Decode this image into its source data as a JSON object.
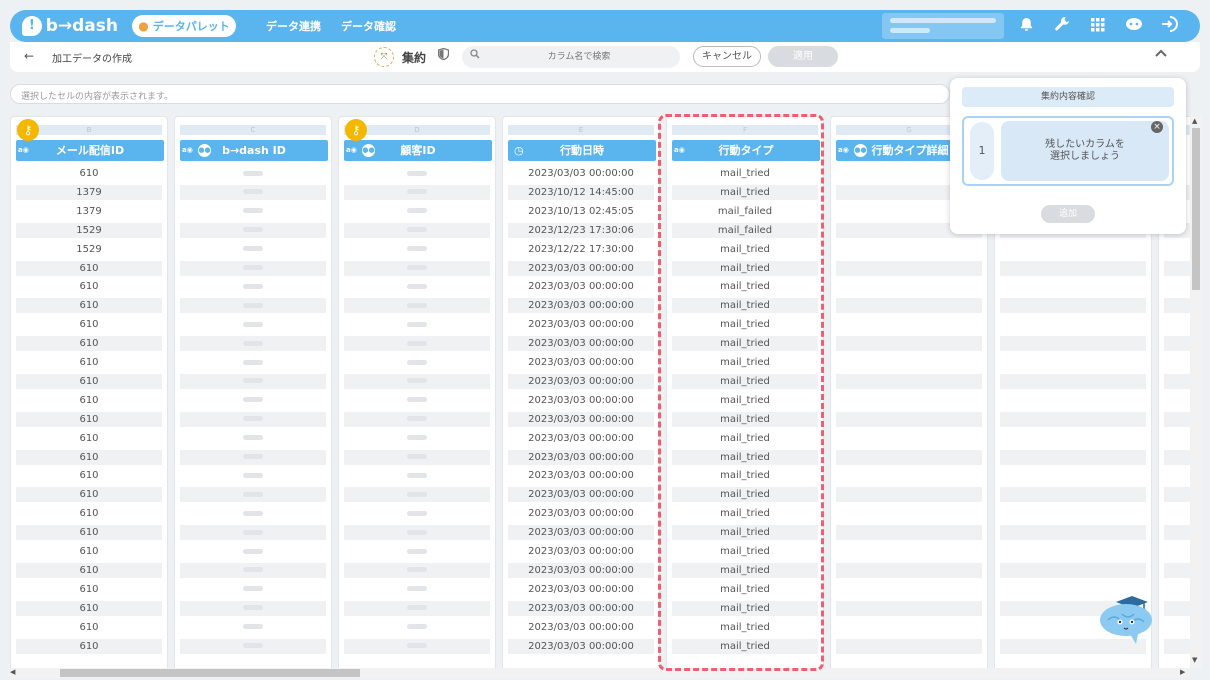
{
  "brand": {
    "name": "b→dash"
  },
  "nav": {
    "palette_label": "データパレット",
    "links": [
      "データ連携",
      "データ確認"
    ]
  },
  "toolbar": {
    "back_glyph": "←",
    "page_title": "加工データの作成",
    "mode_label": "集約",
    "search_placeholder": "カラム名で検索",
    "cancel_label": "キャンセル",
    "apply_label": "適用"
  },
  "cell_content": {
    "placeholder": "選択したセルの内容が表示されます。"
  },
  "columns": [
    {
      "letter": "B",
      "header": "メール配信ID",
      "tag": "a",
      "key": true
    },
    {
      "letter": "C",
      "header": "b→dash ID",
      "tag": "a",
      "key": false
    },
    {
      "letter": "D",
      "header": "顧客ID",
      "tag": "a",
      "key": true
    },
    {
      "letter": "E",
      "header": "行動日時",
      "tag": "",
      "key": false
    },
    {
      "letter": "F",
      "header": "行動タイプ",
      "tag": "a",
      "key": false
    },
    {
      "letter": "G",
      "header": "行動タイプ詳細",
      "tag": "a",
      "key": false
    }
  ],
  "mail_ids": [
    "610",
    "1379",
    "1379",
    "1529",
    "1529",
    "610",
    "610",
    "610",
    "610",
    "610",
    "610",
    "610",
    "610",
    "610",
    "610",
    "610",
    "610",
    "610",
    "610",
    "610",
    "610",
    "610",
    "610",
    "610",
    "610",
    "610"
  ],
  "datetimes": [
    "2023/03/03 00:00:00",
    "2023/10/12 14:45:00",
    "2023/10/13 02:45:05",
    "2023/12/23 17:30:06",
    "2023/12/22 17:30:00",
    "2023/03/03 00:00:00",
    "2023/03/03 00:00:00",
    "2023/03/03 00:00:00",
    "2023/03/03 00:00:00",
    "2023/03/03 00:00:00",
    "2023/03/03 00:00:00",
    "2023/03/03 00:00:00",
    "2023/03/03 00:00:00",
    "2023/03/03 00:00:00",
    "2023/03/03 00:00:00",
    "2023/03/03 00:00:00",
    "2023/03/03 00:00:00",
    "2023/03/03 00:00:00",
    "2023/03/03 00:00:00",
    "2023/03/03 00:00:00",
    "2023/03/03 00:00:00",
    "2023/03/03 00:00:00",
    "2023/03/03 00:00:00",
    "2023/03/03 00:00:00",
    "2023/03/03 00:00:00",
    "2023/03/03 00:00:00"
  ],
  "action_types": [
    "mail_tried",
    "mail_tried",
    "mail_failed",
    "mail_failed",
    "mail_tried",
    "mail_tried",
    "mail_tried",
    "mail_tried",
    "mail_tried",
    "mail_tried",
    "mail_tried",
    "mail_tried",
    "mail_tried",
    "mail_tried",
    "mail_tried",
    "mail_tried",
    "mail_tried",
    "mail_tried",
    "mail_tried",
    "mail_tried",
    "mail_tried",
    "mail_tried",
    "mail_tried",
    "mail_tried",
    "mail_tried",
    "mail_tried"
  ],
  "agg_panel": {
    "title": "集約内容確認",
    "item_number": "1",
    "message_line1": "残したいカラムを",
    "message_line2": "選択しましょう",
    "add_label": "追加"
  },
  "colors": {
    "accent": "#5ab4ee",
    "highlight": "#ee6070",
    "key": "#f5b800"
  },
  "icons": [
    "bell-icon",
    "wrench-icon",
    "grid-icon",
    "cloud-icon",
    "logout-icon",
    "search-icon",
    "shield-icon",
    "key-icon",
    "clock-icon",
    "chevron-up-icon"
  ]
}
